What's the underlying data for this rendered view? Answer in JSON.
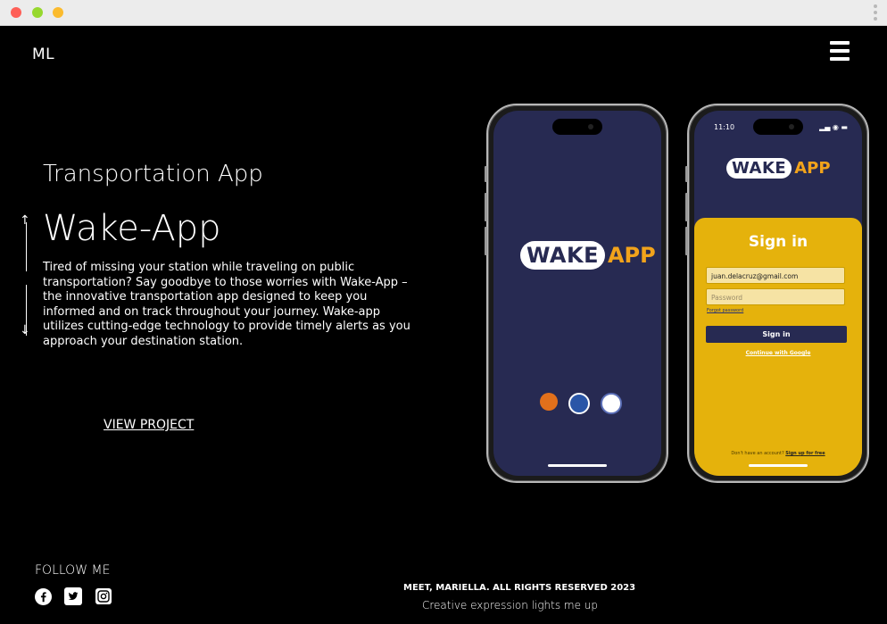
{
  "header": {
    "logo": "ML"
  },
  "project": {
    "subtitle": "Transportation App",
    "title": "Wake-App",
    "description": "Tired of missing your station while traveling on public transportation? Say goodbye to those worries with Wake-App – the innovative transportation app designed to keep you informed and on track throughout your journey. Wake-app utilizes cutting-edge technology to provide timely alerts as you approach your destination station.",
    "link_label": "VIEW PROJECT"
  },
  "mockup": {
    "brand_wake": "WAKE",
    "brand_app": "APP",
    "status_time": "11:10",
    "signin_title": "Sign in",
    "email_value": "juan.delacruz@gmail.com",
    "password_placeholder": "Password",
    "forgot_label": "Forgot password",
    "signin_button": "Sign in",
    "google_label": "Continue with Google",
    "no_account_text": "Don't have an account?",
    "signup_label": "Sign up for free"
  },
  "footer": {
    "follow_label": "FOLLOW ME",
    "socials": [
      "facebook-icon",
      "twitter-icon",
      "instagram-icon"
    ],
    "rights": "MEET, MARIELLA. ALL RIGHTS RESERVED 2023",
    "tagline": "Creative expression lights me up"
  },
  "colors": {
    "navy": "#272a52",
    "brand_orange": "#f2a31b",
    "signin_yellow": "#e5b20c"
  }
}
